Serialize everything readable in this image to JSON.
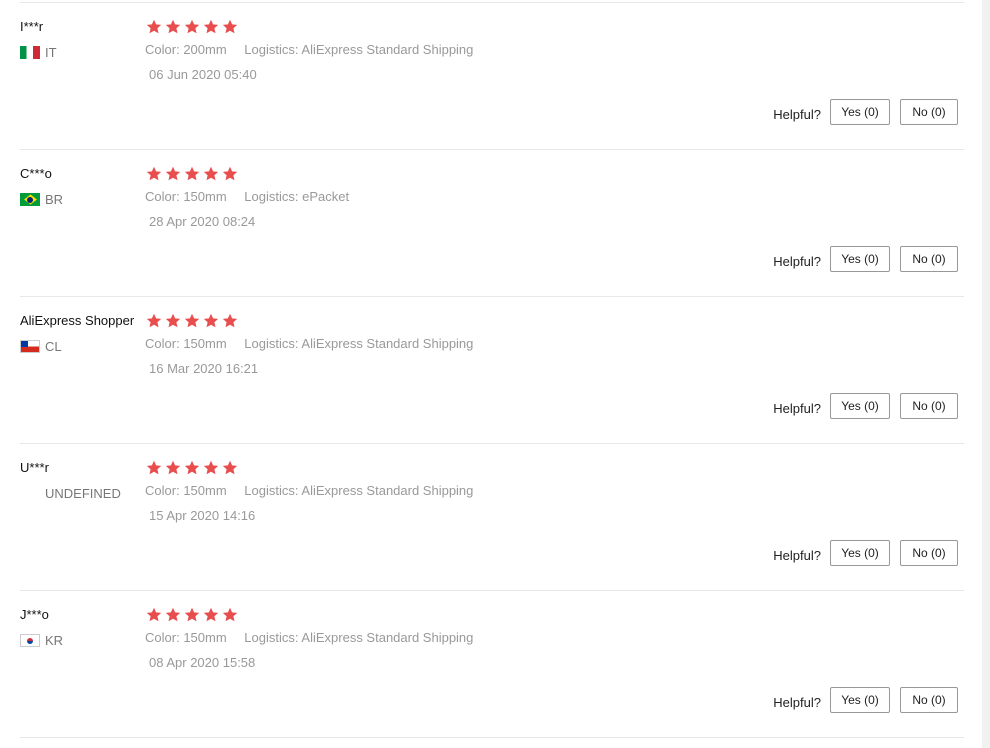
{
  "star_color": "#e94e4e",
  "labels": {
    "color": "Color:",
    "logistics": "Logistics:",
    "helpful": "Helpful?"
  },
  "reviews": [
    {
      "user": "I***r",
      "country": "IT",
      "flag": "italy-flag",
      "rating": 5,
      "color": "200mm",
      "logistics": "AliExpress Standard Shipping",
      "date": "06 Jun 2020 05:40",
      "yes": "Yes (0)",
      "no": "No (0)"
    },
    {
      "user": "C***o",
      "country": "BR",
      "flag": "brazil-flag",
      "rating": 5,
      "color": "150mm",
      "logistics": "ePacket",
      "date": "28 Apr 2020 08:24",
      "yes": "Yes (0)",
      "no": "No (0)"
    },
    {
      "user": "AliExpress Shopper",
      "country": "CL",
      "flag": "chile-flag",
      "rating": 5,
      "color": "150mm",
      "logistics": "AliExpress Standard Shipping",
      "date": "16 Mar 2020 16:21",
      "yes": "Yes (0)",
      "no": "No (0)"
    },
    {
      "user": "U***r",
      "country": "UNDEFINED",
      "flag": "",
      "rating": 5,
      "color": "150mm",
      "logistics": "AliExpress Standard Shipping",
      "date": "15 Apr 2020 14:16",
      "yes": "Yes (0)",
      "no": "No (0)"
    },
    {
      "user": "J***o",
      "country": "KR",
      "flag": "korea-flag",
      "rating": 5,
      "color": "150mm",
      "logistics": "AliExpress Standard Shipping",
      "date": "08 Apr 2020 15:58",
      "yes": "Yes (0)",
      "no": "No (0)"
    }
  ]
}
